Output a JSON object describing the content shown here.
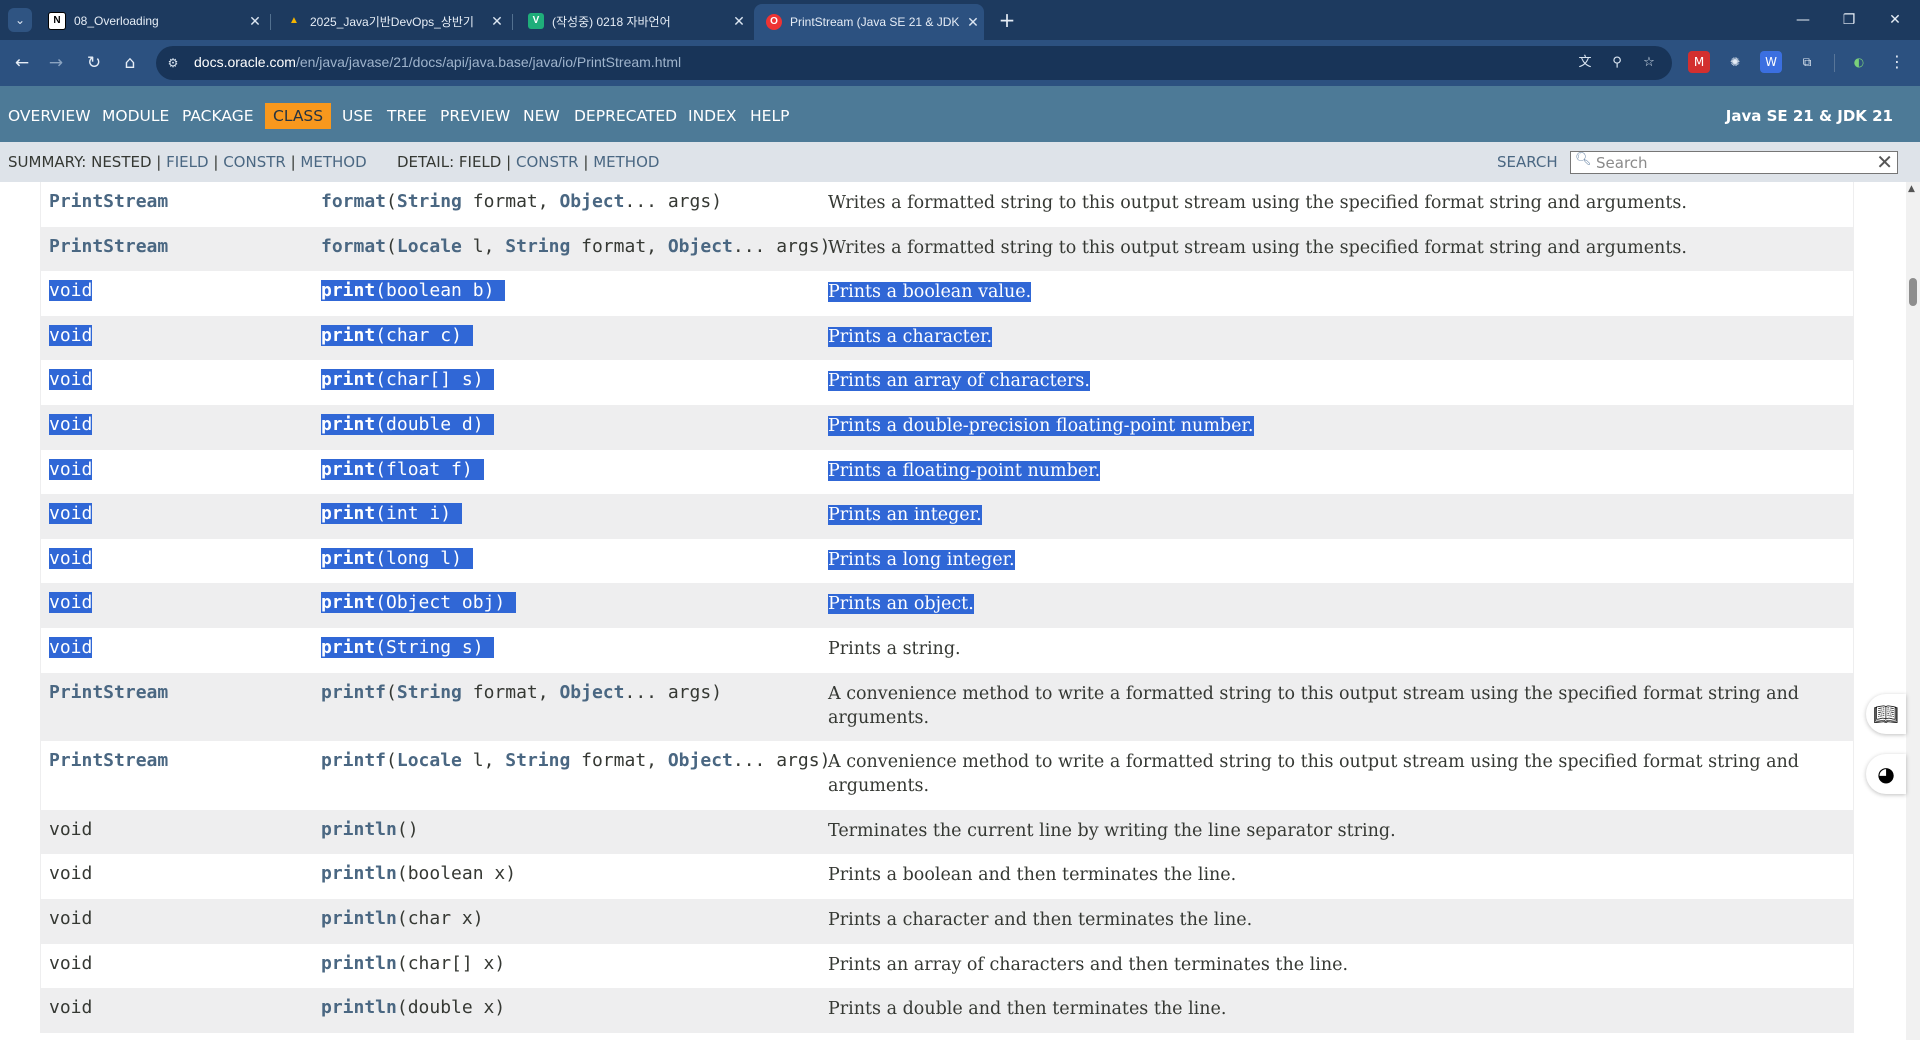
{
  "browser": {
    "tabs": [
      {
        "title": "08_Overloading",
        "favicon": "N"
      },
      {
        "title": "2025_Java기반DevOps_상반기",
        "favicon": "▲"
      },
      {
        "title": "(작성중) 0218 자바언어",
        "favicon": "V"
      },
      {
        "title": "PrintStream (Java SE 21 & JDK",
        "favicon": "O",
        "active": true
      }
    ],
    "url_host": "docs.oracle.com",
    "url_path": "/en/java/javase/21/docs/api/java.base/java/io/PrintStream.html"
  },
  "javadoc": {
    "nav": [
      "OVERVIEW",
      "MODULE",
      "PACKAGE",
      "CLASS",
      "USE",
      "TREE",
      "PREVIEW",
      "NEW",
      "DEPRECATED",
      "INDEX",
      "HELP"
    ],
    "active_nav": "CLASS",
    "version": "Java SE 21 & JDK 21",
    "summary_label": "SUMMARY: NESTED |",
    "summary_links": [
      "FIELD",
      "CONSTR",
      "METHOD"
    ],
    "detail_label": "DETAIL:",
    "detail_links": [
      "FIELD",
      "CONSTR",
      "METHOD"
    ],
    "sep": "|",
    "search_label": "SEARCH",
    "search_placeholder": "Search",
    "search_reset": "✕"
  },
  "methods": [
    {
      "ret": "PrintStream",
      "name": "format",
      "params": [
        [
          "String",
          " format, "
        ],
        [
          "Object",
          "... args"
        ]
      ],
      "desc": "Writes a formatted string to this output stream using the specified format string and arguments."
    },
    {
      "ret": "PrintStream",
      "name": "format",
      "params": [
        [
          "Locale",
          " l, "
        ],
        [
          "String",
          " format, "
        ],
        [
          "Object",
          "... args"
        ]
      ],
      "desc": "Writes a formatted string to this output stream using the specified format string and arguments."
    },
    {
      "ret": "void",
      "name": "print",
      "params": [
        [
          "",
          "boolean b"
        ]
      ],
      "desc": "Prints a boolean value.",
      "hl": "full"
    },
    {
      "ret": "void",
      "name": "print",
      "params": [
        [
          "",
          "char c"
        ]
      ],
      "desc": "Prints a character.",
      "hl": "full"
    },
    {
      "ret": "void",
      "name": "print",
      "params": [
        [
          "",
          "char[] s"
        ]
      ],
      "desc": "Prints an array of characters.",
      "hl": "full"
    },
    {
      "ret": "void",
      "name": "print",
      "params": [
        [
          "",
          "double d"
        ]
      ],
      "desc": "Prints a double-precision floating-point number.",
      "hl": "full"
    },
    {
      "ret": "void",
      "name": "print",
      "params": [
        [
          "",
          "float f"
        ]
      ],
      "desc": "Prints a floating-point number.",
      "hl": "full"
    },
    {
      "ret": "void",
      "name": "print",
      "params": [
        [
          "",
          "int i"
        ]
      ],
      "desc": "Prints an integer.",
      "hl": "full"
    },
    {
      "ret": "void",
      "name": "print",
      "params": [
        [
          "",
          "long l"
        ]
      ],
      "desc": "Prints a long integer.",
      "hl": "full"
    },
    {
      "ret": "void",
      "name": "print",
      "params": [
        [
          "",
          "Object obj"
        ]
      ],
      "desc": "Prints an object.",
      "hl": "full"
    },
    {
      "ret": "void",
      "name": "print",
      "params": [
        [
          "",
          "String s"
        ]
      ],
      "desc": "Prints a string.",
      "hl": "partial"
    },
    {
      "ret": "PrintStream",
      "name": "printf",
      "params": [
        [
          "String",
          " format, "
        ],
        [
          "Object",
          "... args"
        ]
      ],
      "desc": "A convenience method to write a formatted string to this output stream using the specified format string and arguments.",
      "tall": true
    },
    {
      "ret": "PrintStream",
      "name": "printf",
      "params": [
        [
          "Locale",
          " l, "
        ],
        [
          "String",
          " format, "
        ],
        [
          "Object",
          "... args"
        ]
      ],
      "desc": "A convenience method to write a formatted string to this output stream using the specified format string and arguments.",
      "tall": true
    },
    {
      "ret": "void",
      "name": "println",
      "params": [],
      "desc": "Terminates the current line by writing the line separator string."
    },
    {
      "ret": "void",
      "name": "println",
      "params": [
        [
          "",
          "boolean x"
        ]
      ],
      "desc": "Prints a boolean and then terminates the line."
    },
    {
      "ret": "void",
      "name": "println",
      "params": [
        [
          "",
          "char x"
        ]
      ],
      "desc": "Prints a character and then terminates the line."
    },
    {
      "ret": "void",
      "name": "println",
      "params": [
        [
          "",
          "char[] x"
        ]
      ],
      "desc": "Prints an array of characters and then terminates the line."
    },
    {
      "ret": "void",
      "name": "println",
      "params": [
        [
          "",
          "double x"
        ]
      ],
      "desc": "Prints a double and then terminates the line."
    }
  ],
  "colors": {
    "nav_bg": "#4d7a97",
    "active_nav_bg": "#f8981d",
    "link": "#4a6782",
    "selection": "#3067d6",
    "odd_row": "#eeeeef"
  }
}
